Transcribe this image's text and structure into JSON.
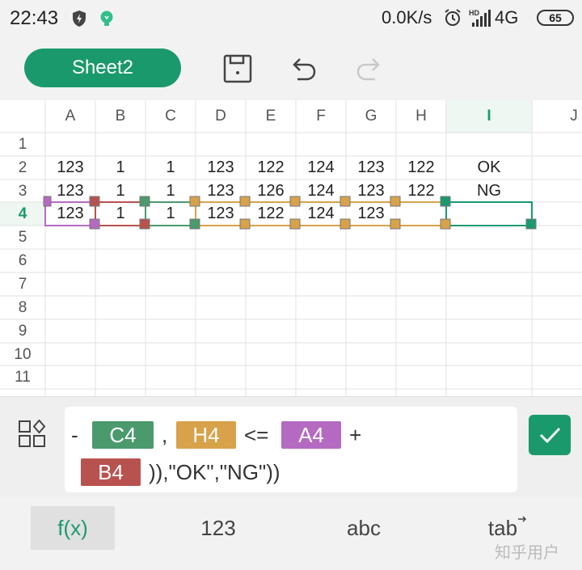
{
  "status_bar": {
    "time": "22:43",
    "net_speed": "0.0K/s",
    "network": "4G",
    "battery": "65",
    "icons": [
      "shield-icon",
      "bulb-icon",
      "alarm-icon",
      "hd-signal-icon"
    ]
  },
  "toolbar": {
    "sheet_label": "Sheet2",
    "icons": [
      "save-icon",
      "undo-icon",
      "redo-icon"
    ]
  },
  "grid": {
    "columns": [
      "A",
      "B",
      "C",
      "D",
      "E",
      "F",
      "G",
      "H",
      "I",
      "J"
    ],
    "active_column": "I",
    "rows": [
      "1",
      "2",
      "3",
      "4",
      "5",
      "6",
      "7",
      "8",
      "9",
      "10",
      "11"
    ],
    "active_row": "4",
    "data": {
      "row2": [
        "123",
        "1",
        "1",
        "123",
        "122",
        "124",
        "123",
        "122",
        "OK"
      ],
      "row3": [
        "123",
        "1",
        "1",
        "123",
        "126",
        "124",
        "123",
        "122",
        "NG"
      ],
      "row4": [
        "123",
        "1",
        "1",
        "123",
        "122",
        "124",
        "123",
        "",
        ""
      ]
    }
  },
  "formula": {
    "line1": {
      "minus": "-",
      "ref_c4": "C4",
      "comma": ",",
      "ref_h4": "H4",
      "op": "<=",
      "ref_a4": "A4",
      "plus": "+"
    },
    "line2": {
      "ref_b4": "B4",
      "tail": ")),\"OK\",\"NG\"))"
    }
  },
  "keyboard_tabs": {
    "fx": "f(x)",
    "num": "123",
    "abc": "abc",
    "tab": "tab"
  },
  "watermark": "知乎用户",
  "colors": {
    "accent_green": "#1a9a6c",
    "ref_green": "#4a9a6e",
    "ref_orange": "#d8a24a",
    "ref_purple": "#b56ac2",
    "ref_red": "#b8524f"
  }
}
